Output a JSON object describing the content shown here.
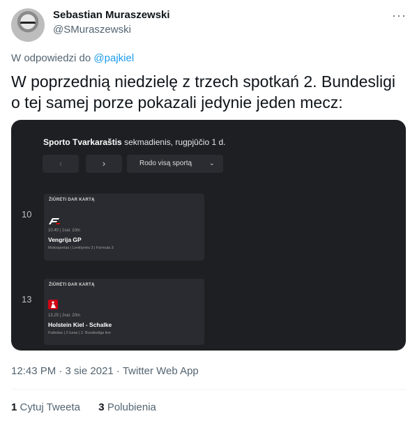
{
  "author": {
    "name": "Sebastian Muraszewski",
    "handle": "@SMuraszewski"
  },
  "reply": {
    "prefix": "W odpowiedzi do",
    "mention": "@pajkiel"
  },
  "tweet_text": "W poprzednią niedzielę z trzech spotkań 2. Bundesligi o tej samej porze pokazali jedynie jeden mecz:",
  "screenshot": {
    "header_brand": "Sporto Tvarkaraštis",
    "header_date": "sekmadienis, rugpjūčio 1 d.",
    "prev_label": "‹",
    "next_label": "›",
    "sport_select": "Rodo visą sportą",
    "hours": [
      "10",
      "13"
    ],
    "cards": [
      {
        "tag": "ŽIŪRĖTI DAR KARTĄ",
        "logo": "formula-3-logo",
        "time": "10.40 | 1val. 10m",
        "title": "Vengrija GP",
        "meta": "Motosportas | Lenktynės 3 | Formula 3"
      },
      {
        "tag": "ŽIŪRĖTI DAR KARTĄ",
        "logo": "bundesliga-2-logo",
        "time": "13.25 | 2val. 20m",
        "title": "Holstein Kiel - Schalke",
        "meta": "Futbolas | 2 turas | 2. Bundesliga live"
      }
    ]
  },
  "footer": {
    "timestamp": "12:43 PM · 3 sie 2021 · Twitter Web App"
  },
  "stats": {
    "quotes_count": "1",
    "quotes_label": "Cytuj Tweeta",
    "likes_count": "3",
    "likes_label": "Polubienia"
  },
  "icons": {
    "more": "more-icon"
  }
}
